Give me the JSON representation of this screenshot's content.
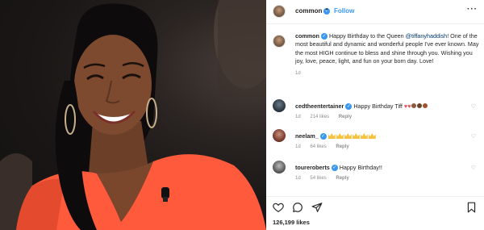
{
  "header": {
    "username": "common",
    "dot": "•",
    "follow_label": "Follow",
    "more_label": "···"
  },
  "caption": {
    "username": "common",
    "text_before": "Happy Birthday to the Queen ",
    "mention": "@tiffanyhaddish",
    "text_after": "! One of the most beautiful and dynamic and wonderful people I've ever known. May the most HIGH continue to bless and shine through you. Wishing you joy, love, peace, light, and fun on your born day. Love!",
    "time": "1d"
  },
  "comments": [
    {
      "username": "cedtheentertainer",
      "text": "Happy Birthday Tiff",
      "likes": "214 likes",
      "time": "1d",
      "reply": "Reply"
    },
    {
      "username": "neelam_",
      "text": "",
      "likes": "64 likes",
      "time": "1d",
      "reply": "Reply"
    },
    {
      "username": "toureroberts",
      "text": "Happy Birthday!!",
      "likes": "54 likes",
      "time": "1d",
      "reply": "Reply"
    }
  ],
  "footer": {
    "likes_count": "126,199 likes"
  },
  "colors": {
    "accent": "#3897f0",
    "dress": "#ff5a3c",
    "heart": "#ed4956"
  }
}
